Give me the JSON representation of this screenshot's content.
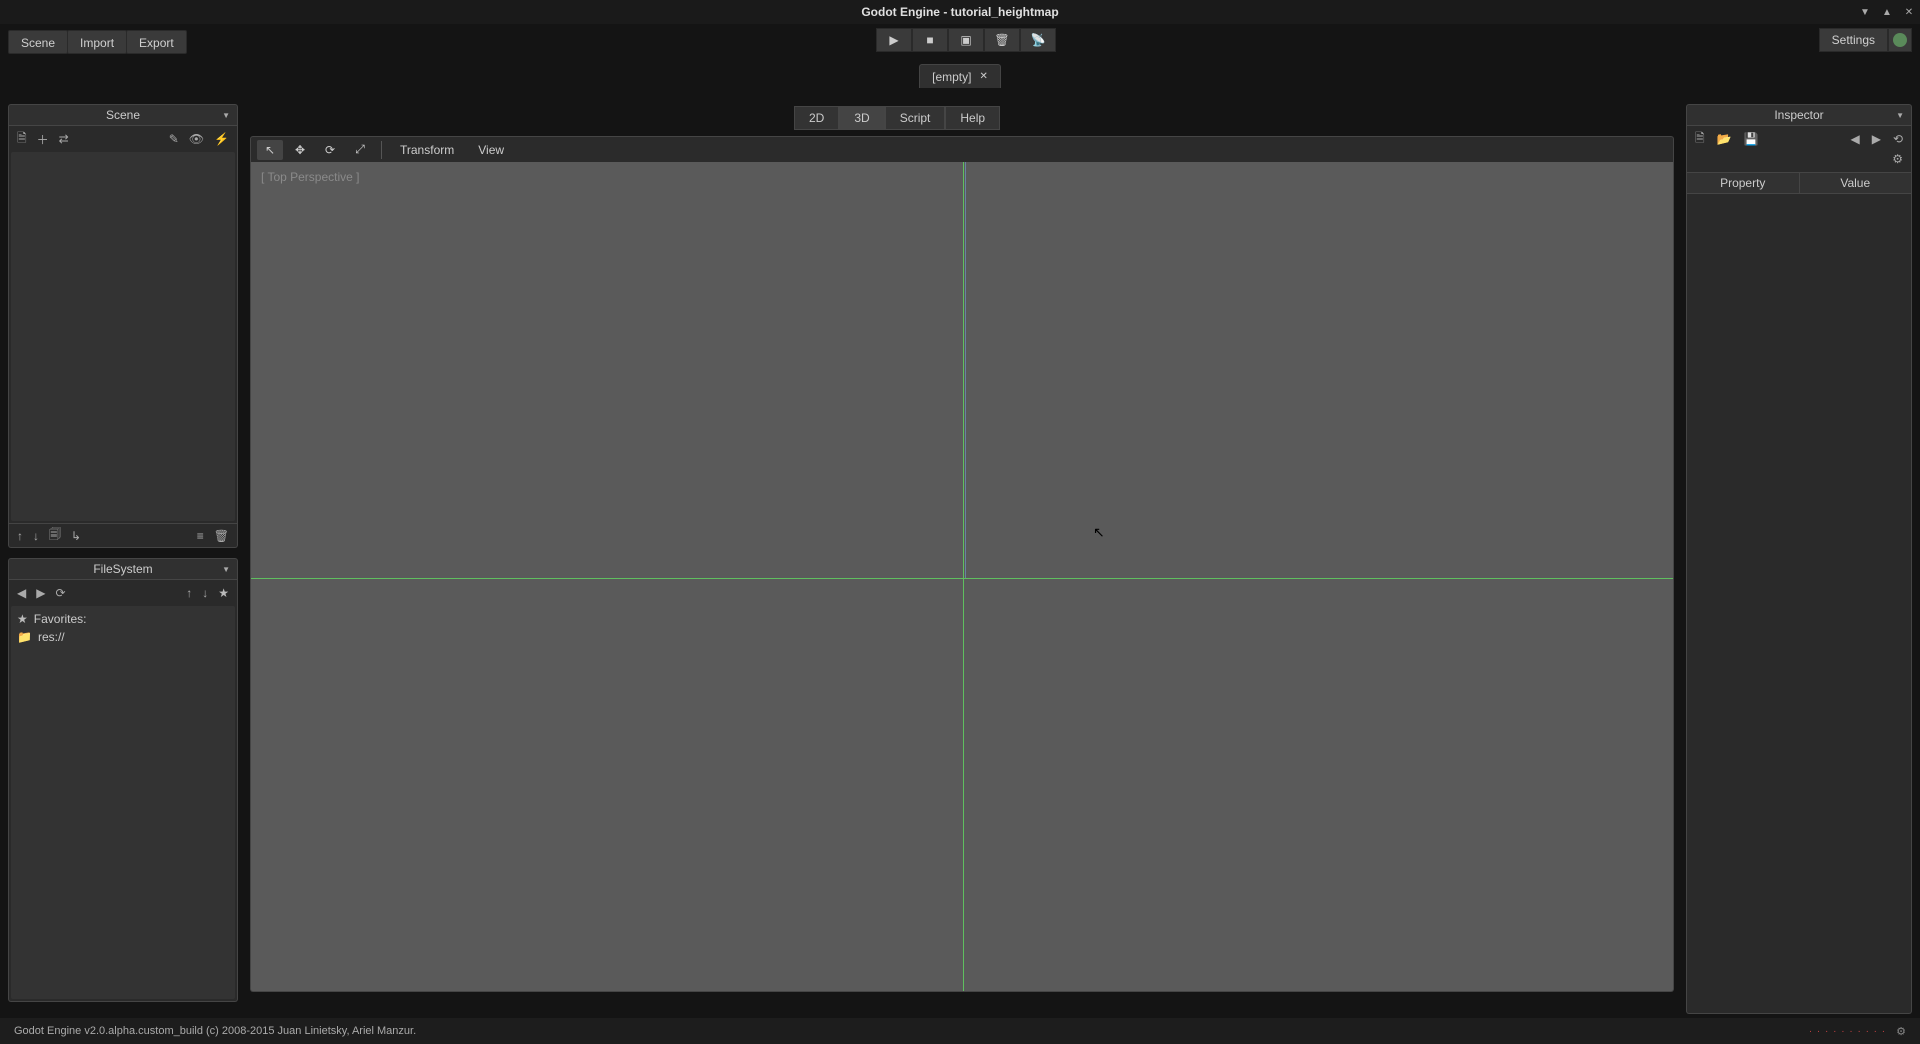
{
  "app": {
    "title": "Godot Engine - tutorial_heightmap"
  },
  "window_controls": [
    "minimize",
    "maximize",
    "close"
  ],
  "menubar": {
    "scene": "Scene",
    "import": "Import",
    "export": "Export",
    "settings": "Settings"
  },
  "play_icons": [
    "play",
    "stop",
    "play-scene",
    "custom-scene",
    "debug"
  ],
  "scene_tab": {
    "label": "[empty]"
  },
  "view_tabs": {
    "d2": "2D",
    "d3": "3D",
    "script": "Script",
    "help": "Help",
    "active": "3D"
  },
  "viewport_toolbar": {
    "transform": "Transform",
    "view": "View"
  },
  "viewport": {
    "label": "[ Top Perspective ]"
  },
  "left": {
    "scene_title": "Scene",
    "filesystem_title": "FileSystem",
    "favorites_label": "Favorites:",
    "res_label": "res://"
  },
  "inspector": {
    "title": "Inspector",
    "col_property": "Property",
    "col_value": "Value"
  },
  "footer": {
    "version": "Godot Engine v2.0.alpha.custom_build (c) 2008-2015 Juan Linietsky, Ariel Manzur."
  }
}
